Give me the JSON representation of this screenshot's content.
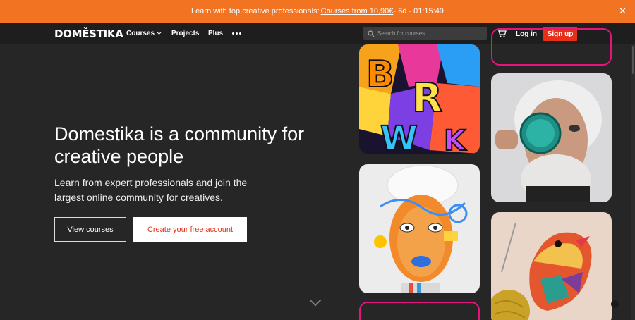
{
  "promo": {
    "text": "Learn with top creative professionals: ",
    "link": "Courses from 10,90€",
    "countdown": " - 6d - 01:15:49",
    "close": "✕"
  },
  "nav": {
    "logo": "DOMĚSTIKA",
    "courses": "Courses",
    "projects": "Projects",
    "plus": "Plus",
    "search_placeholder": "Search for courses",
    "login": "Log in",
    "signup": "Sign up"
  },
  "hero": {
    "title": "Domestika is a community for creative people",
    "subtitle": "Learn from expert professionals and join the largest online community for creatives.",
    "view_courses": "View courses",
    "create_account": "Create your free account"
  },
  "colors": {
    "promo": "#f27321",
    "accent": "#e7301a",
    "nav_bg": "#1e1e1e",
    "page_bg": "#262626",
    "card_outline": "#e5157d"
  },
  "info": "i"
}
